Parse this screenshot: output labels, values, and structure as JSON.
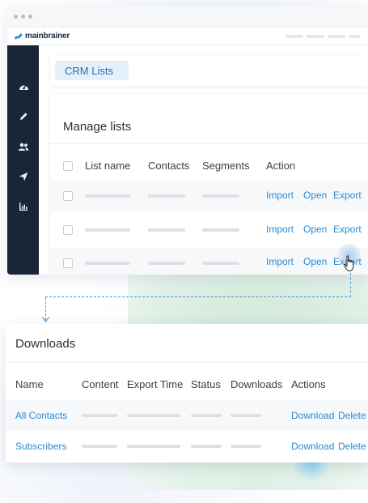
{
  "app": {
    "logo_text": "mainbrainer",
    "breadcrumb_tab": "CRM Lists",
    "sidebar_icons": [
      "dashboard-icon",
      "pencil-icon",
      "users-icon",
      "send-icon",
      "report-icon"
    ]
  },
  "manage_lists": {
    "title": "Manage lists",
    "columns": {
      "list_name": "List name",
      "contacts": "Contacts",
      "segments": "Segments",
      "action": "Action"
    },
    "rows": [
      {
        "import": "Import",
        "open": "Open",
        "export": "Export"
      },
      {
        "import": "Import",
        "open": "Open",
        "export": "Export"
      },
      {
        "import": "Import",
        "open": "Open",
        "export": "Export"
      }
    ]
  },
  "downloads": {
    "title": "Downloads",
    "columns": {
      "name": "Name",
      "content": "Content",
      "export_time": "Export Time",
      "status": "Status",
      "downloads": "Downloads",
      "actions": "Actions"
    },
    "rows": [
      {
        "name": "All Contacts",
        "download": "Download",
        "delete": "Delete"
      },
      {
        "name": "Subscribers",
        "download": "Download",
        "delete": "Delete"
      }
    ]
  },
  "colors": {
    "sidebar": "#182638",
    "link": "#2a8bd0",
    "tab_bg": "#e4f0fa",
    "connector": "#4d97d4",
    "green_area": "#d8ecdf"
  }
}
